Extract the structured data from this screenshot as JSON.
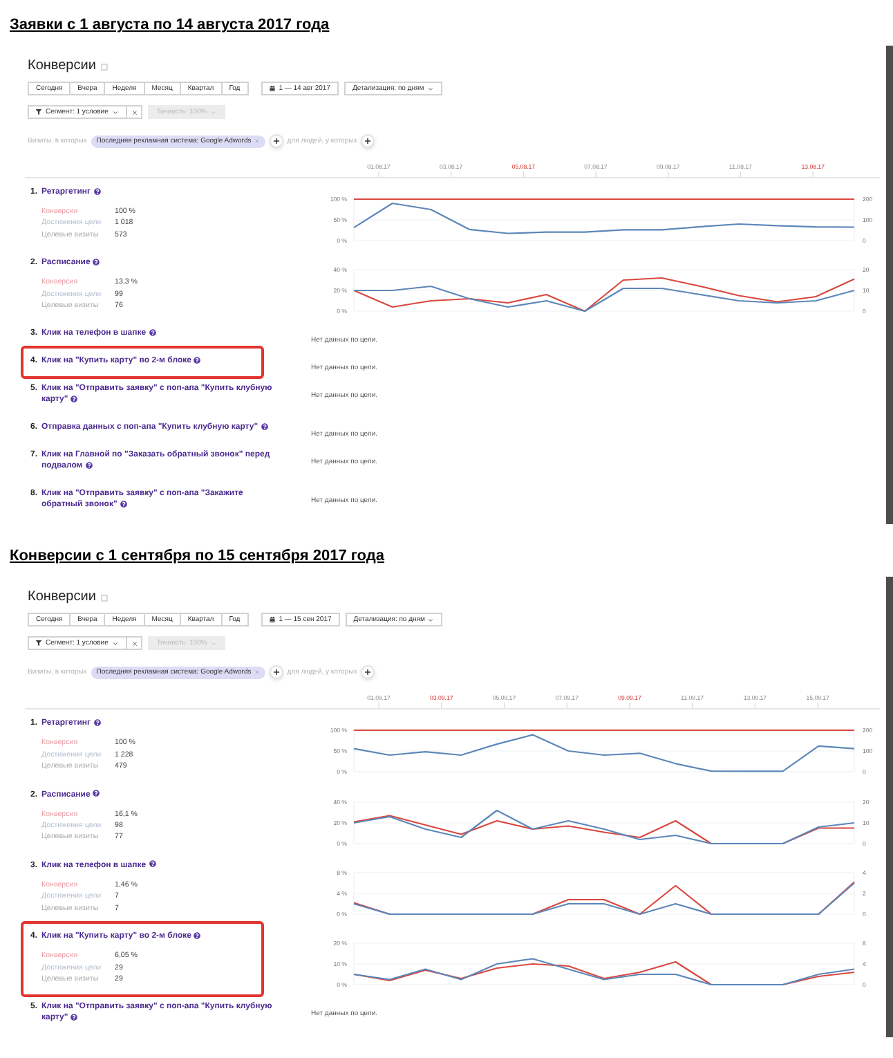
{
  "sections": [
    {
      "heading": "Заявки с 1 августа по 14 августа 2017 года",
      "report": {
        "title": "Конверсии",
        "periods": [
          "Сегодня",
          "Вчера",
          "Неделя",
          "Месяц",
          "Квартал",
          "Год"
        ],
        "date_range": "1 — 14 авг 2017",
        "grouping": "Детализация: по дням",
        "segment": "Сегмент: 1 условие",
        "accuracy": {
          "label": "Точность: 100%",
          "disabled": true
        },
        "filter": {
          "prefix": "Визиты, в которых",
          "chip": "Последняя рекламная система: Google Adwords",
          "people_prefix": "для людей, у которых"
        },
        "date_axis": [
          {
            "label": "01.08.17",
            "weekend": false
          },
          {
            "label": "03.08.17",
            "weekend": false
          },
          {
            "label": "05.08.17",
            "weekend": true
          },
          {
            "label": "07.08.17",
            "weekend": false
          },
          {
            "label": "09.08.17",
            "weekend": false
          },
          {
            "label": "11.08.17",
            "weekend": false
          },
          {
            "label": "13.08.17",
            "weekend": true
          }
        ],
        "goals": [
          {
            "kind": "chart",
            "number": "1.",
            "name": "Ретаргетинг",
            "highlighted": false,
            "stats": [
              {
                "label": "Конверсия",
                "value": "100 %",
                "color": "#e89ca4"
              },
              {
                "label": "Достижения цели",
                "value": "1 018",
                "color": "#b3bfd2"
              },
              {
                "label": "Целевые визиты",
                "value": "573",
                "color": "#ababab"
              }
            ],
            "chart_data": {
              "type": "line",
              "ylim": [
                0,
                100
              ],
              "yticks": [
                {
                  "value": 0,
                  "label": "0 %"
                },
                {
                  "value": 50,
                  "label": "50 %"
                },
                {
                  "value": 100,
                  "label": "100 %"
                }
              ],
              "y2lim": [
                0,
                200
              ],
              "y2ticks": [
                {
                  "value": 0,
                  "label": "0"
                },
                {
                  "value": 100,
                  "label": "100"
                },
                {
                  "value": 200,
                  "label": "200"
                }
              ],
              "series": [
                {
                  "color": "#d9473f",
                  "values": [
                    100,
                    100,
                    100,
                    100,
                    100,
                    100,
                    100,
                    100,
                    100,
                    100,
                    100,
                    100,
                    100,
                    100
                  ]
                },
                {
                  "color": "#5b87b9",
                  "axis": "y2",
                  "values": [
                    63,
                    180,
                    150,
                    54,
                    35,
                    41,
                    41,
                    52,
                    52,
                    67,
                    80,
                    72,
                    66,
                    65
                  ]
                }
              ]
            }
          },
          {
            "kind": "chart",
            "number": "2.",
            "name": "Расписание",
            "highlighted": false,
            "stats": [
              {
                "label": "Конверсия",
                "value": "13,3 %",
                "color": "#e89ca4"
              },
              {
                "label": "Достижения цели",
                "value": "99",
                "color": "#b3bfd2"
              },
              {
                "label": "Целевые визиты",
                "value": "76",
                "color": "#ababab"
              }
            ],
            "chart_data": {
              "type": "line",
              "ylim": [
                0,
                40
              ],
              "yticks": [
                {
                  "value": 0,
                  "label": "0 %"
                },
                {
                  "value": 20,
                  "label": "20 %"
                },
                {
                  "value": 40,
                  "label": "40 %"
                }
              ],
              "y2lim": [
                0,
                20
              ],
              "y2ticks": [
                {
                  "value": 0,
                  "label": "0"
                },
                {
                  "value": 10,
                  "label": "10"
                },
                {
                  "value": 20,
                  "label": "20"
                }
              ],
              "series": [
                {
                  "color": "#d9473f",
                  "values": [
                    20,
                    4,
                    10,
                    12,
                    8,
                    16,
                    0,
                    30,
                    32,
                    24,
                    15,
                    9,
                    14,
                    31
                  ]
                },
                {
                  "color": "#5b87b9",
                  "axis": "y2",
                  "values": [
                    10,
                    10,
                    12,
                    6,
                    2,
                    5,
                    0,
                    11,
                    11,
                    8,
                    5,
                    4,
                    5,
                    10
                  ]
                }
              ]
            }
          },
          {
            "kind": "empty",
            "number": "3.",
            "name": "Клик на телефон в шапке",
            "highlighted": false,
            "no_data": "Нет данных по цели."
          },
          {
            "kind": "empty",
            "number": "4.",
            "name": "Клик на \"Купить карту\" во 2-м блоке",
            "highlighted": true,
            "no_data": "Нет данных по цели."
          },
          {
            "kind": "empty",
            "number": "5.",
            "name": "Клик на \"Отправить заявку\" с поп-апа \"Купить клубную карту\"",
            "highlighted": false,
            "no_data": "Нет данных по цели."
          },
          {
            "kind": "empty",
            "number": "6.",
            "name": "Отправка данных с поп-апа \"Купить клубную карту\"",
            "highlighted": false,
            "no_data": "Нет данных по цели."
          },
          {
            "kind": "empty",
            "number": "7.",
            "name": "Клик на Главной по \"Заказать обратный звонок\" перед подвалом",
            "highlighted": false,
            "no_data": "Нет данных по цели."
          },
          {
            "kind": "empty",
            "number": "8.",
            "name": "Клик на \"Отправить заявку\" с поп-апа \"Закажите обратный звонок\"",
            "highlighted": false,
            "no_data": "Нет данных по цели."
          }
        ]
      }
    },
    {
      "heading": "Конверсии с 1 сентября по 15 сентября 2017 года",
      "report": {
        "title": "Конверсии",
        "periods": [
          "Сегодня",
          "Вчера",
          "Неделя",
          "Месяц",
          "Квартал",
          "Год"
        ],
        "date_range": "1 — 15 сен 2017",
        "grouping": "Детализация: по дням",
        "segment": "Сегмент: 1 условие",
        "accuracy": {
          "label": "Точность: 100%",
          "disabled": true
        },
        "filter": {
          "prefix": "Визиты, в которых",
          "chip": "Последняя рекламная система: Google Adwords",
          "people_prefix": "для людей, у которых"
        },
        "date_axis": [
          {
            "label": "01.09.17",
            "weekend": false
          },
          {
            "label": "03.09.17",
            "weekend": true
          },
          {
            "label": "05.09.17",
            "weekend": false
          },
          {
            "label": "07.09.17",
            "weekend": false
          },
          {
            "label": "09.09.17",
            "weekend": true
          },
          {
            "label": "11.09.17",
            "weekend": false
          },
          {
            "label": "13.09.17",
            "weekend": false
          },
          {
            "label": "15.09.17",
            "weekend": false
          }
        ],
        "goals": [
          {
            "kind": "chart",
            "number": "1.",
            "name": "Ретаргетинг",
            "highlighted": false,
            "stats": [
              {
                "label": "Конверсия",
                "value": "100 %",
                "color": "#e89ca4"
              },
              {
                "label": "Достижения цели",
                "value": "1 228",
                "color": "#b3bfd2"
              },
              {
                "label": "Целевые визиты",
                "value": "479",
                "color": "#ababab"
              }
            ],
            "chart_data": {
              "type": "line",
              "ylim": [
                0,
                100
              ],
              "yticks": [
                {
                  "value": 0,
                  "label": "0 %"
                },
                {
                  "value": 50,
                  "label": "50 %"
                },
                {
                  "value": 100,
                  "label": "100 %"
                }
              ],
              "y2lim": [
                0,
                200
              ],
              "y2ticks": [
                {
                  "value": 0,
                  "label": "0"
                },
                {
                  "value": 100,
                  "label": "100"
                },
                {
                  "value": 200,
                  "label": "200"
                }
              ],
              "series": [
                {
                  "color": "#d9473f",
                  "values": [
                    100,
                    100,
                    100,
                    100,
                    100,
                    100,
                    100,
                    100,
                    100,
                    100,
                    100,
                    100,
                    100,
                    100,
                    100
                  ]
                },
                {
                  "color": "#5b87b9",
                  "axis": "y2",
                  "values": [
                    111,
                    80,
                    96,
                    80,
                    133,
                    178,
                    100,
                    80,
                    89,
                    39,
                    3,
                    2,
                    2,
                    124,
                    111
                  ]
                }
              ]
            }
          },
          {
            "kind": "chart",
            "number": "2.",
            "name": "Расписание",
            "highlighted": false,
            "stats": [
              {
                "label": "Конверсия",
                "value": "16,1 %",
                "color": "#e89ca4"
              },
              {
                "label": "Достижения цели",
                "value": "98",
                "color": "#b3bfd2"
              },
              {
                "label": "Целевые визиты",
                "value": "77",
                "color": "#ababab"
              }
            ],
            "chart_data": {
              "type": "line",
              "ylim": [
                0,
                40
              ],
              "yticks": [
                {
                  "value": 0,
                  "label": "0 %"
                },
                {
                  "value": 20,
                  "label": "20 %"
                },
                {
                  "value": 40,
                  "label": "40 %"
                }
              ],
              "y2lim": [
                0,
                20
              ],
              "y2ticks": [
                {
                  "value": 0,
                  "label": "0"
                },
                {
                  "value": 10,
                  "label": "10"
                },
                {
                  "value": 20,
                  "label": "20"
                }
              ],
              "series": [
                {
                  "color": "#d9473f",
                  "values": [
                    21,
                    27,
                    18,
                    9,
                    22,
                    14,
                    17,
                    11,
                    6,
                    22,
                    0,
                    0,
                    0,
                    15,
                    15
                  ]
                },
                {
                  "color": "#5b87b9",
                  "axis": "y2",
                  "values": [
                    10,
                    13,
                    7,
                    3,
                    16,
                    7,
                    11,
                    7,
                    2,
                    4,
                    0,
                    0,
                    0,
                    8,
                    10
                  ]
                }
              ]
            }
          },
          {
            "kind": "chart",
            "number": "3.",
            "name": "Клик на телефон в шапке",
            "highlighted": false,
            "stats": [
              {
                "label": "Конверсия",
                "value": "1,46 %",
                "color": "#e89ca4"
              },
              {
                "label": "Достижения цели",
                "value": "7",
                "color": "#b3bfd2"
              },
              {
                "label": "Целевые визиты",
                "value": "7",
                "color": "#ababab"
              }
            ],
            "chart_data": {
              "type": "line",
              "ylim": [
                0,
                8
              ],
              "yticks": [
                {
                  "value": 0,
                  "label": "0 %"
                },
                {
                  "value": 4,
                  "label": "4 %"
                },
                {
                  "value": 8,
                  "label": "8 %"
                }
              ],
              "y2lim": [
                0,
                4
              ],
              "y2ticks": [
                {
                  "value": 0,
                  "label": "0"
                },
                {
                  "value": 2,
                  "label": "2"
                },
                {
                  "value": 4,
                  "label": "4"
                }
              ],
              "series": [
                {
                  "color": "#d9473f",
                  "values": [
                    2.2,
                    0,
                    0,
                    0,
                    0,
                    0,
                    2.8,
                    2.8,
                    0,
                    5.5,
                    0,
                    0,
                    0,
                    0,
                    6.2
                  ]
                },
                {
                  "color": "#5b87b9",
                  "axis": "y2",
                  "values": [
                    1,
                    0,
                    0,
                    0,
                    0,
                    0,
                    1,
                    1,
                    0,
                    1,
                    0,
                    0,
                    0,
                    0,
                    3
                  ]
                }
              ]
            }
          },
          {
            "kind": "chart",
            "number": "4.",
            "name": "Клик на \"Купить карту\" во 2-м блоке",
            "highlighted": true,
            "stats": [
              {
                "label": "Конверсия",
                "value": "6,05 %",
                "color": "#e89ca4"
              },
              {
                "label": "Достижения цели",
                "value": "29",
                "color": "#b3bfd2"
              },
              {
                "label": "Целевые визиты",
                "value": "29",
                "color": "#ababab"
              }
            ],
            "chart_data": {
              "type": "line",
              "ylim": [
                0,
                20
              ],
              "yticks": [
                {
                  "value": 0,
                  "label": "0 %"
                },
                {
                  "value": 10,
                  "label": "10 %"
                },
                {
                  "value": 20,
                  "label": "20 %"
                }
              ],
              "y2lim": [
                0,
                8
              ],
              "y2ticks": [
                {
                  "value": 0,
                  "label": "0"
                },
                {
                  "value": 4,
                  "label": "4"
                },
                {
                  "value": 8,
                  "label": "8"
                }
              ],
              "series": [
                {
                  "color": "#d9473f",
                  "values": [
                    5,
                    2,
                    7,
                    3,
                    8,
                    10,
                    9,
                    3,
                    6,
                    11,
                    0,
                    0,
                    0,
                    4,
                    6
                  ]
                },
                {
                  "color": "#5b87b9",
                  "axis": "y2",
                  "values": [
                    2,
                    1,
                    3,
                    1,
                    4,
                    5,
                    3,
                    1,
                    2,
                    2,
                    0,
                    0,
                    0,
                    2,
                    3
                  ]
                }
              ]
            }
          },
          {
            "kind": "empty",
            "number": "5.",
            "name": "Клик на \"Отправить заявку\" с поп-апа \"Купить клубную карту\"",
            "highlighted": false,
            "no_data": "Нет данных по цели."
          }
        ]
      }
    }
  ]
}
